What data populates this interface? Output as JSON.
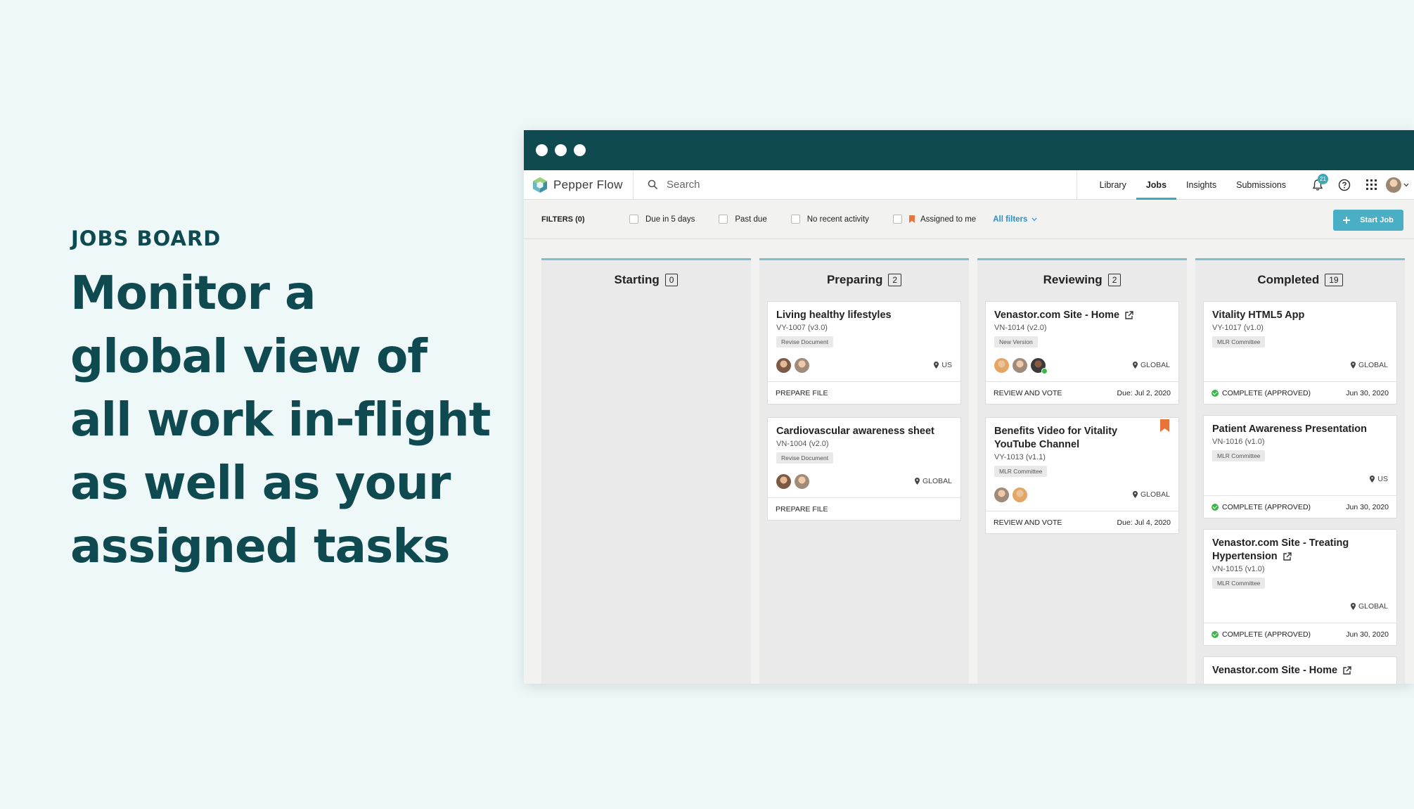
{
  "hero": {
    "kicker": "JOBS BOARD",
    "headline_lines": [
      "Monitor a",
      "global view of",
      "all work in-flight",
      "as well as your",
      "assigned tasks"
    ]
  },
  "app": {
    "brand": "Pepper Flow",
    "search_placeholder": "Search",
    "nav": [
      "Library",
      "Jobs",
      "Insights",
      "Submissions"
    ],
    "active_nav": "Jobs",
    "notification_count": "21",
    "filters": {
      "title": "FILTERS (0)",
      "options": [
        "Due in 5 days",
        "Past due",
        "No recent activity",
        "Assigned to me"
      ],
      "all_filters": "All filters"
    },
    "start_job_label": "Start Job",
    "accent_color": "#0f4a50",
    "button_color": "#4aaec4"
  },
  "columns": [
    {
      "title": "Starting",
      "count": "0",
      "cards": []
    },
    {
      "title": "Preparing",
      "count": "2",
      "cards": [
        {
          "title": "Living healthy lifestyles",
          "id": "VY-1007 (v3.0)",
          "tag": "Revise Document",
          "region": "US",
          "status": "PREPARE FILE",
          "due": ""
        },
        {
          "title": "Cardiovascular awareness sheet",
          "id": "VN-1004 (v2.0)",
          "tag": "Revise Document",
          "region": "GLOBAL",
          "status": "PREPARE FILE",
          "due": ""
        }
      ]
    },
    {
      "title": "Reviewing",
      "count": "2",
      "cards": [
        {
          "title": "Venastor.com Site - Home",
          "id": "VN-1014 (v2.0)",
          "tag": "New Version",
          "region": "GLOBAL",
          "status": "REVIEW AND VOTE",
          "due": "Due: Jul 2, 2020"
        },
        {
          "title_lines": [
            "Benefits Video for Vitality",
            "YouTube Channel"
          ],
          "id": "VY-1013 (v1.1)",
          "tag": "MLR Committee",
          "region": "GLOBAL",
          "status": "REVIEW AND VOTE",
          "due": "Due: Jul 4, 2020"
        }
      ]
    },
    {
      "title": "Completed",
      "count": "19",
      "cards": [
        {
          "title": "Vitality HTML5 App",
          "id": "VY-1017 (v1.0)",
          "tag": "MLR Committee",
          "region": "GLOBAL",
          "status": "COMPLETE (APPROVED)",
          "due": "Jun 30, 2020"
        },
        {
          "title": "Patient Awareness Presentation",
          "id": "VN-1016 (v1.0)",
          "tag": "MLR Committee",
          "region": "US",
          "status": "COMPLETE (APPROVED)",
          "due": "Jun 30, 2020"
        },
        {
          "title_lines": [
            "Venastor.com Site - Treating",
            "Hypertension"
          ],
          "id": "VN-1015 (v1.0)",
          "tag": "MLR Committee",
          "region": "GLOBAL",
          "status": "COMPLETE (APPROVED)",
          "due": "Jun 30, 2020"
        },
        {
          "title": "Venastor.com Site - Home"
        }
      ]
    }
  ]
}
